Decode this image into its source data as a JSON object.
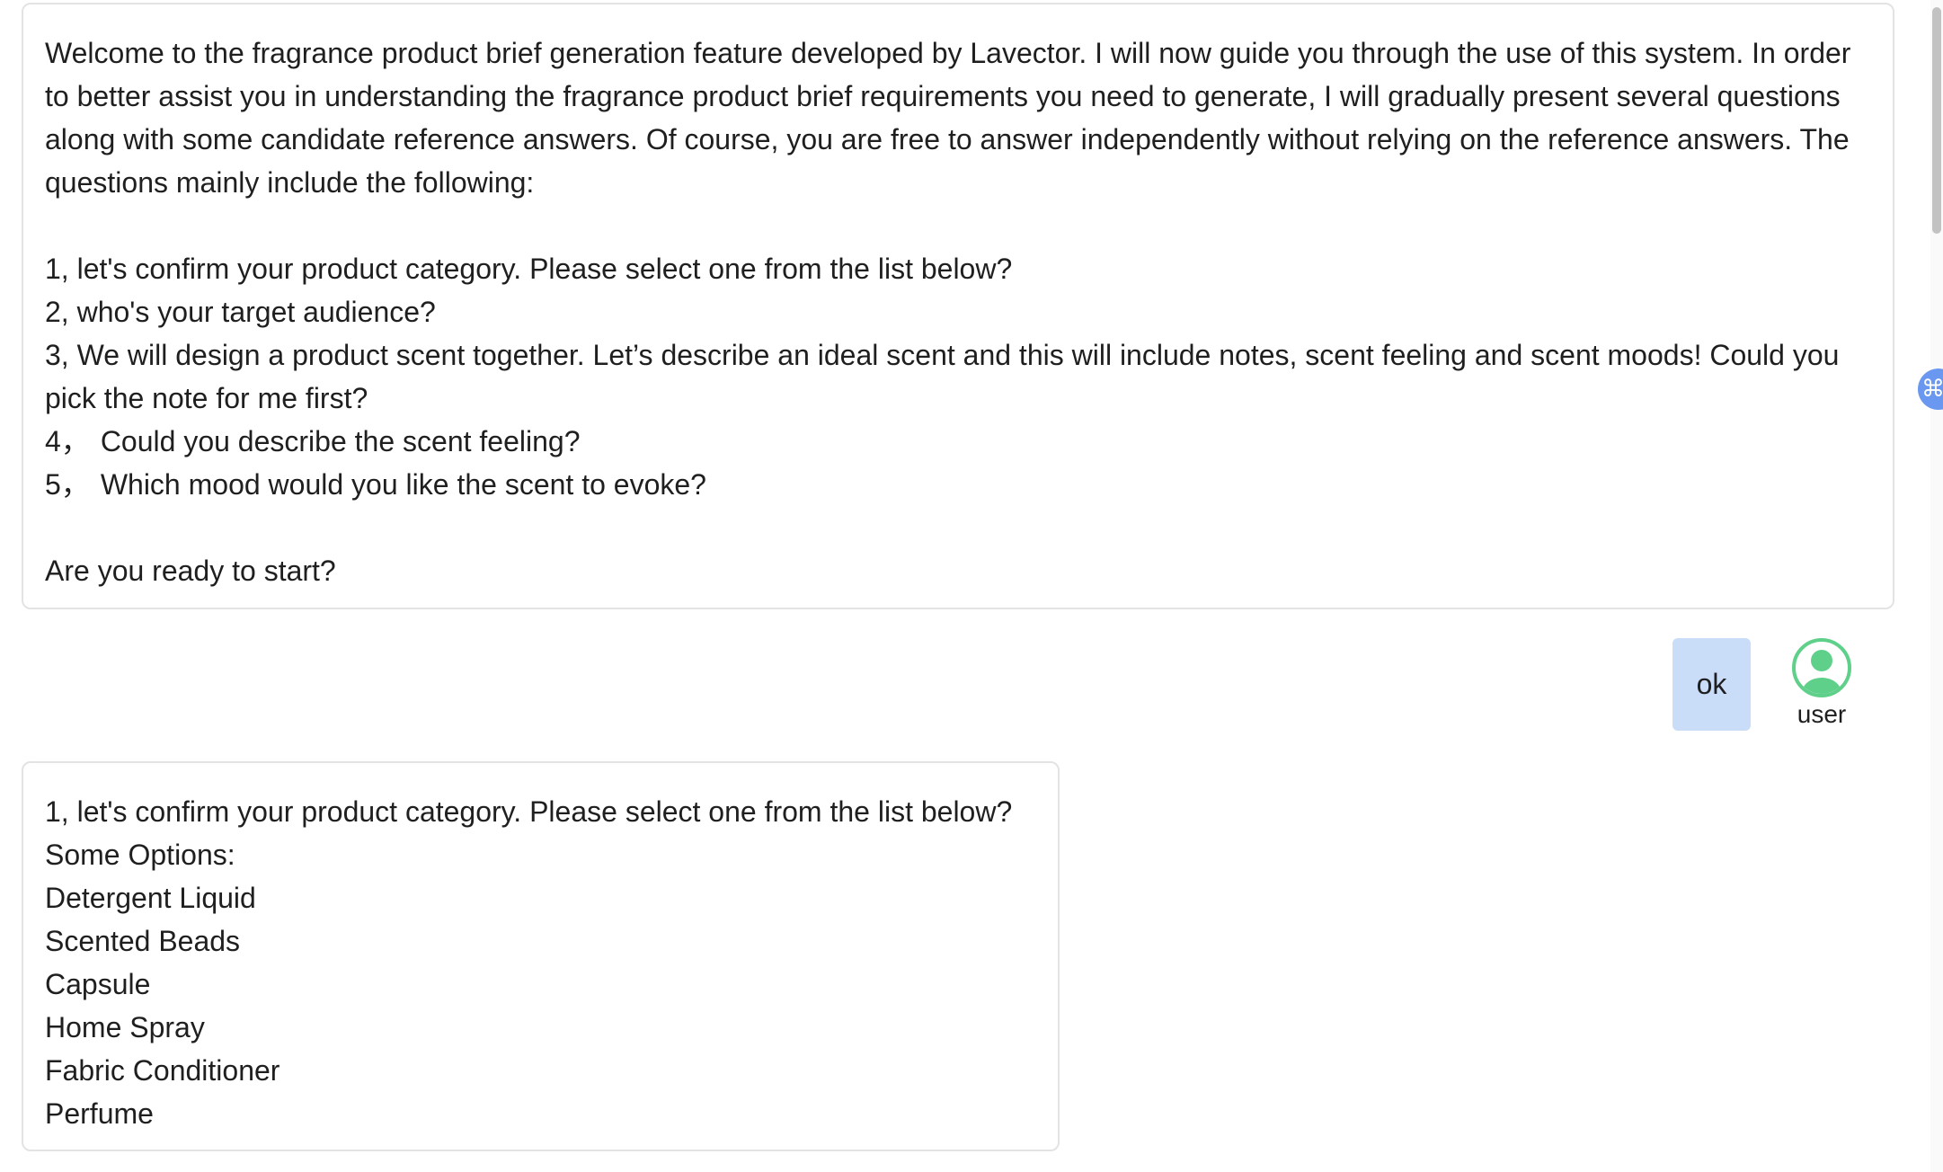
{
  "welcome": {
    "intro": "Welcome to the fragrance product brief generation feature developed by Lavector. I will now guide you through the use of this system. In order to better assist you in understanding the fragrance product brief requirements you need to generate, I will gradually present several questions along with some candidate reference answers. Of course, you are free to answer independently without relying on the reference answers. The questions mainly include the following:",
    "q1": "1, let's confirm your product category. Please select one from the list below?",
    "q2": "2, who's your target audience?",
    "q3": "3, We will design a product scent together. Let’s describe an ideal scent and this will include notes, scent feeling and scent moods! Could you pick the note for me first?",
    "q4_num": "4，",
    "q4_text": "Could you describe the scent feeling?",
    "q5_num": "5，",
    "q5_text": "Which mood would you like the scent to evoke?",
    "ready": "Are you ready to start?"
  },
  "user_message": {
    "text": "ok",
    "sender": "user",
    "bubble_color": "#c9dcf8",
    "avatar_color": "#5fd08a",
    "avatar_icon": "user-circle-icon"
  },
  "category_question": {
    "question": "1, let's confirm your product category. Please select one from the list below?",
    "options_label": "Some Options:",
    "options": [
      "Detergent Liquid",
      "Scented Beads",
      "Capsule",
      "Home Spray",
      "Fabric Conditioner",
      "Perfume"
    ]
  },
  "side_widget": {
    "icon": "command-icon",
    "glyph": "⌘",
    "color": "#6a97f0"
  }
}
